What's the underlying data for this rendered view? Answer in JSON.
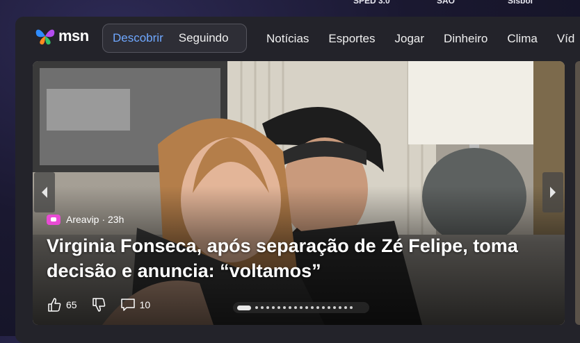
{
  "top_strip": [
    "SPED 3.0",
    "SÃO",
    "Sisbol"
  ],
  "brand": {
    "logo_text": "msn"
  },
  "feed_tabs": {
    "active": "Descobrir",
    "inactive": "Seguindo"
  },
  "nav": [
    "Notícias",
    "Esportes",
    "Jogar",
    "Dinheiro",
    "Clima",
    "Víd"
  ],
  "hero": {
    "source": "Areavip",
    "age": "· 23h",
    "headline": "Virginia Fonseca, após separação de Zé Felipe, toma decisão e anuncia: “voltamos”",
    "likes": "65",
    "comments": "10",
    "carousel": {
      "total": 19,
      "current": 1
    }
  },
  "colors": {
    "active_tab": "#6fa8ff",
    "source_badge": "#e94bd4"
  }
}
